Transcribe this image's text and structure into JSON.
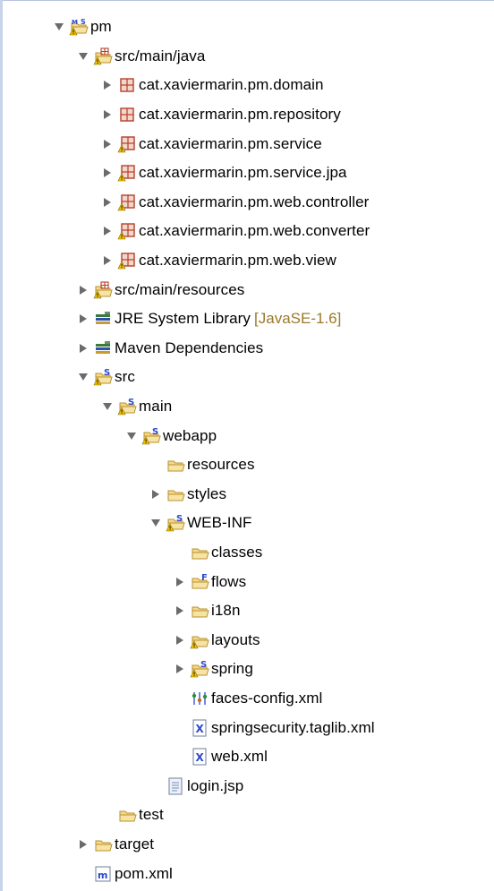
{
  "tree": {
    "nodes": [
      {
        "label": "pm",
        "icon": "maven-project-icon",
        "depth": 0,
        "toggle": "expanded"
      },
      {
        "label": "src/main/java",
        "icon": "source-folder-icon",
        "depth": 1,
        "toggle": "expanded"
      },
      {
        "label": "cat.xaviermarin.pm.domain",
        "icon": "package-icon",
        "depth": 2,
        "toggle": "collapsed"
      },
      {
        "label": "cat.xaviermarin.pm.repository",
        "icon": "package-icon",
        "depth": 2,
        "toggle": "collapsed"
      },
      {
        "label": "cat.xaviermarin.pm.service",
        "icon": "package-warning-icon",
        "depth": 2,
        "toggle": "collapsed"
      },
      {
        "label": "cat.xaviermarin.pm.service.jpa",
        "icon": "package-warning-icon",
        "depth": 2,
        "toggle": "collapsed"
      },
      {
        "label": "cat.xaviermarin.pm.web.controller",
        "icon": "package-warning-icon",
        "depth": 2,
        "toggle": "collapsed"
      },
      {
        "label": "cat.xaviermarin.pm.web.converter",
        "icon": "package-warning-icon",
        "depth": 2,
        "toggle": "collapsed"
      },
      {
        "label": "cat.xaviermarin.pm.web.view",
        "icon": "package-warning-icon",
        "depth": 2,
        "toggle": "collapsed"
      },
      {
        "label": "src/main/resources",
        "icon": "source-folder-icon",
        "depth": 1,
        "toggle": "collapsed"
      },
      {
        "label": "JRE System Library",
        "decoration": "[JavaSE-1.6]",
        "icon": "library-icon",
        "depth": 1,
        "toggle": "collapsed"
      },
      {
        "label": "Maven Dependencies",
        "icon": "library-icon",
        "depth": 1,
        "toggle": "collapsed"
      },
      {
        "label": "src",
        "icon": "spring-folder-warning-icon",
        "depth": 1,
        "toggle": "expanded"
      },
      {
        "label": "main",
        "icon": "spring-folder-warning-icon",
        "depth": 2,
        "toggle": "expanded"
      },
      {
        "label": "webapp",
        "icon": "spring-folder-warning-icon",
        "depth": 3,
        "toggle": "expanded"
      },
      {
        "label": "resources",
        "icon": "folder-icon",
        "depth": 4,
        "toggle": "none"
      },
      {
        "label": "styles",
        "icon": "folder-icon",
        "depth": 4,
        "toggle": "collapsed"
      },
      {
        "label": "WEB-INF",
        "icon": "spring-folder-warning-icon",
        "depth": 4,
        "toggle": "expanded"
      },
      {
        "label": "classes",
        "icon": "folder-icon",
        "depth": 5,
        "toggle": "none"
      },
      {
        "label": "flows",
        "icon": "flow-folder-icon",
        "depth": 5,
        "toggle": "collapsed"
      },
      {
        "label": "i18n",
        "icon": "folder-icon",
        "depth": 5,
        "toggle": "collapsed"
      },
      {
        "label": "layouts",
        "icon": "folder-warning-icon",
        "depth": 5,
        "toggle": "collapsed"
      },
      {
        "label": "spring",
        "icon": "spring-folder-warning-icon",
        "depth": 5,
        "toggle": "collapsed"
      },
      {
        "label": "faces-config.xml",
        "icon": "faces-config-icon",
        "depth": 5,
        "toggle": "none"
      },
      {
        "label": "springsecurity.taglib.xml",
        "icon": "xml-file-icon",
        "depth": 5,
        "toggle": "none"
      },
      {
        "label": "web.xml",
        "icon": "xml-file-icon",
        "depth": 5,
        "toggle": "none"
      },
      {
        "label": "login.jsp",
        "icon": "jsp-file-icon",
        "depth": 4,
        "toggle": "none"
      },
      {
        "label": "test",
        "icon": "folder-icon",
        "depth": 2,
        "toggle": "none"
      },
      {
        "label": "target",
        "icon": "folder-icon",
        "depth": 1,
        "toggle": "collapsed"
      },
      {
        "label": "pom.xml",
        "icon": "maven-pom-icon",
        "depth": 1,
        "toggle": "none"
      }
    ]
  },
  "colors": {
    "triangle": "#6b6b6b",
    "folder": "#f4d98b",
    "folderStroke": "#b9922c",
    "package": "#b5402a",
    "warning": "#f2c200",
    "spring": "#2b49d0",
    "decoration": "#9b7a2b"
  }
}
